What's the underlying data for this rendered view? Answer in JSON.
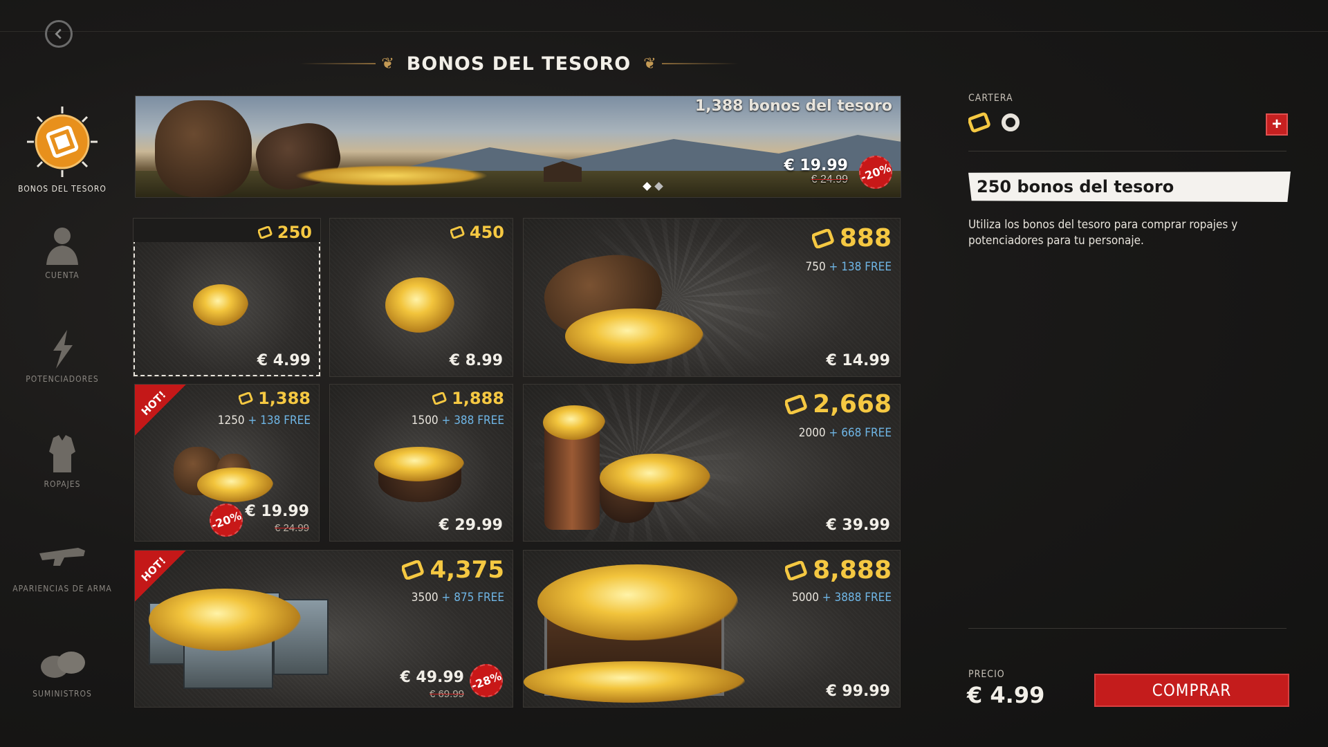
{
  "header": {
    "title": "BONOS DEL TESORO"
  },
  "sidebar": {
    "items": [
      {
        "label": "BONOS DEL TESORO",
        "icon": "treasure-bonds-icon",
        "active": true
      },
      {
        "label": "CUENTA",
        "icon": "user-icon"
      },
      {
        "label": "POTENCIADORES",
        "icon": "lightning-icon"
      },
      {
        "label": "ROPAJES",
        "icon": "clothing-icon"
      },
      {
        "label": "APARIENCIAS DE ARMA",
        "icon": "gun-icon"
      },
      {
        "label": "SUMINISTROS",
        "icon": "supplies-icon"
      }
    ]
  },
  "banner": {
    "bonus_text": "1,388 bonos del tesoro",
    "price": "€ 19.99",
    "old_price": "€ 24.99",
    "discount": "-20%"
  },
  "products": [
    {
      "amount": "250",
      "price": "€ 4.99",
      "selected": true
    },
    {
      "amount": "450",
      "price": "€ 8.99"
    },
    {
      "amount": "888",
      "base": "750",
      "free": "+ 138 FREE",
      "price": "€ 14.99"
    },
    {
      "amount": "1,388",
      "base": "1250",
      "free": "+ 138 FREE",
      "price": "€ 19.99",
      "old_price": "€ 24.99",
      "discount": "-20%",
      "hot": "HOT!"
    },
    {
      "amount": "1,888",
      "base": "1500",
      "free": "+ 388 FREE",
      "price": "€ 29.99"
    },
    {
      "amount": "2,668",
      "base": "2000",
      "free": "+ 668 FREE",
      "price": "€ 39.99"
    },
    {
      "amount": "4,375",
      "base": "3500",
      "free": "+ 875 FREE",
      "price": "€ 49.99",
      "old_price": "€ 69.99",
      "discount": "-28%",
      "hot": "HOT!"
    },
    {
      "amount": "8,888",
      "base": "5000",
      "free": "+ 3888 FREE",
      "price": "€ 99.99"
    }
  ],
  "wallet": {
    "label": "CARTERA",
    "add_label": "+"
  },
  "selected": {
    "title": "250 bonos del tesoro",
    "description": "Utiliza los bonos del tesoro para comprar ropajes y potenciadores para tu personaje."
  },
  "purchase": {
    "price_label": "PRECIO",
    "price": "€ 4.99",
    "buy_label": "COMPRAR"
  },
  "colors": {
    "accent": "#f5c842",
    "free": "#6fb6e6",
    "buy": "#c41c1c",
    "hot": "#c41818"
  }
}
